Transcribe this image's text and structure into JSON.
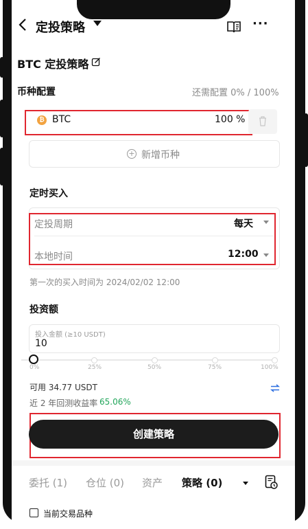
{
  "header": {
    "back_icon": "chevron-left-icon",
    "title": "定投策略",
    "title_dropdown_icon": "caret-down-icon",
    "guide_icon": "book-icon",
    "more_icon": "more-icon",
    "more_label": "···"
  },
  "strategy": {
    "name": "BTC 定投策略",
    "edit_icon": "edit-icon"
  },
  "currency_config": {
    "section_title": "币种配置",
    "remaining": "还需配置 0% / 100%",
    "coin_name": "BTC",
    "coin_icon_letter": "₿",
    "coin_percent": "100 %",
    "delete_icon": "trash-icon",
    "add_label": "新增币种"
  },
  "schedule": {
    "section_title": "定时买入",
    "period_label": "定投周期",
    "period_value": "每天",
    "time_label": "本地时间",
    "time_value": "12:00",
    "first_buy_note": "第一次的买入时间为 2024/02/02 12:00"
  },
  "investment": {
    "section_title": "投资额",
    "input_label": "投入金额 (≥10 USDT)",
    "input_value": "10",
    "slider_level_percent": 0,
    "slider_ticks": [
      "0%",
      "25%",
      "50%",
      "75%",
      "100%"
    ],
    "available": "可用 34.77 USDT",
    "transfer_icon": "transfer-icon",
    "backtest_label": "近 2 年回测收益率",
    "backtest_value": "65.06%",
    "backtest_color": "#21a55a"
  },
  "actions": {
    "create_label": "创建策略"
  },
  "bottom_tabs": {
    "items": [
      "委托 (1)",
      "仓位 (0)",
      "资产",
      "策略 (0)"
    ],
    "active_index": 3,
    "active_dropdown_icon": "caret-down-icon",
    "history_icon": "history-icon",
    "filter_label": "当前交易品种"
  },
  "colors": {
    "highlight_border": "#e0262f",
    "primary_button": "#1c1c1c",
    "btc_orange": "#f2a341"
  }
}
